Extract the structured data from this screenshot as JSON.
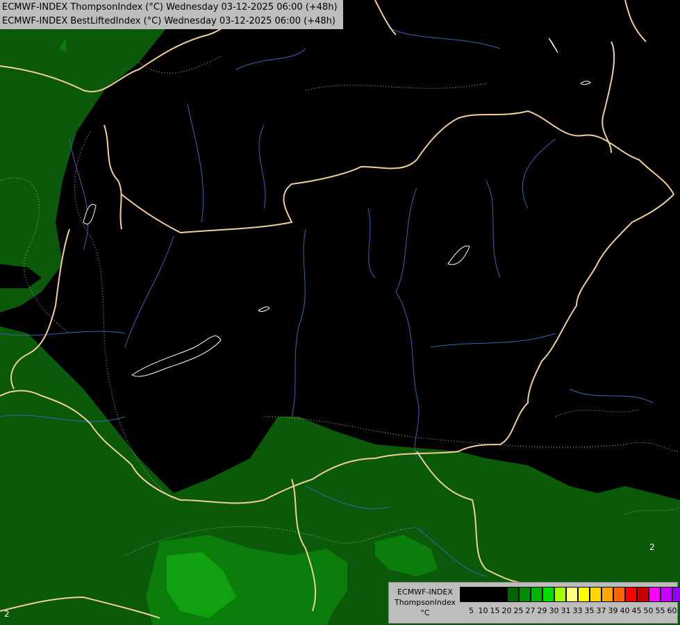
{
  "header": {
    "line1": "ECMWF-INDEX ThompsonIndex (°C) Wednesday 03-12-2025 06:00 (+48h)",
    "line2": "ECMWF-INDEX BestLiftedIndex (°C) Wednesday 03-12-2025 06:00 (+48h)"
  },
  "legend": {
    "label_line1": "ECMWF-INDEX",
    "label_line2": "ThompsonIndex",
    "label_line3": "°C",
    "swatch_colors": [
      "#000000",
      "#000000",
      "#000000",
      "#000000",
      "#006400",
      "#008c00",
      "#00b400",
      "#00dc00",
      "#a0ff00",
      "#ffff80",
      "#ffff00",
      "#ffd700",
      "#ffa500",
      "#ff6400",
      "#ff0000",
      "#c80000",
      "#ff00ff",
      "#c800ff",
      "#9600ff",
      "#6400ff",
      "#0000ff"
    ],
    "ticks": [
      "5",
      "10",
      "15",
      "20",
      "25",
      "27",
      "29",
      "30",
      "31",
      "33",
      "35",
      "37",
      "39",
      "40",
      "45",
      "50",
      "55",
      "60"
    ]
  },
  "contour_labels": {
    "label_east": "2",
    "label_sw": "2"
  }
}
